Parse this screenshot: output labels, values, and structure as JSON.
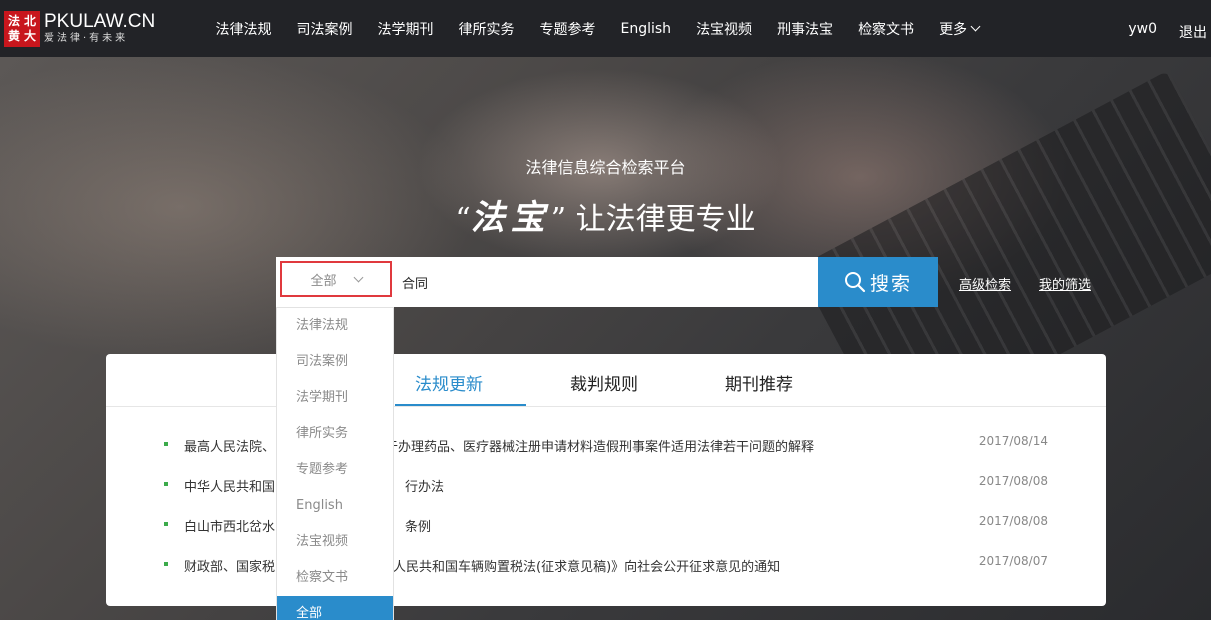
{
  "logo": {
    "seal": [
      "法",
      "北",
      "黄",
      "大"
    ],
    "brand": "PKULAW.CN",
    "slogan": "爱法律·有未来"
  },
  "nav": {
    "items": [
      "法律法规",
      "司法案例",
      "法学期刊",
      "律所实务",
      "专题参考",
      "English",
      "法宝视频",
      "刑事法宝",
      "检察文书"
    ],
    "more_label": "更多",
    "user": "yw0",
    "logout": "退出"
  },
  "hero": {
    "subtitle": "法律信息综合检索平台",
    "title_quote_open": "“",
    "title_brand": "法宝",
    "title_quote_close": "”",
    "title_rest": " 让法律更专业"
  },
  "search": {
    "scope_selected": "全部",
    "query": "合同",
    "button_label": "搜索",
    "advanced_label": "高级检索",
    "my_filter_label": "我的筛选"
  },
  "dropdown": {
    "options": [
      "法律法规",
      "司法案例",
      "法学期刊",
      "律所实务",
      "专题参考",
      "English",
      "法宝视频",
      "检察文书",
      "全部"
    ],
    "selected": "全部"
  },
  "panel": {
    "tabs": [
      "法规更新",
      "裁判规则",
      "期刊推荐"
    ],
    "active_tab": "法规更新",
    "news": [
      {
        "left": "最高人民法院、",
        "right": "于办理药品、医疗器械注册申请材料造假刑事案件适用法律若干问题的解释",
        "date": "2017/08/14"
      },
      {
        "left": "中华人民共和国",
        "right": "行办法",
        "date": "2017/08/08"
      },
      {
        "left": "白山市西北岔水",
        "right": "条例",
        "date": "2017/08/08"
      },
      {
        "left": "财政部、国家税",
        "right": "人民共和国车辆购置税法(征求意见稿)》向社会公开征求意见的通知",
        "date": "2017/08/07"
      }
    ]
  },
  "colors": {
    "accent": "#2a8ccb",
    "topbar": "#222327",
    "highlight_border": "#e0393e",
    "bullet": "#3cab4b"
  }
}
